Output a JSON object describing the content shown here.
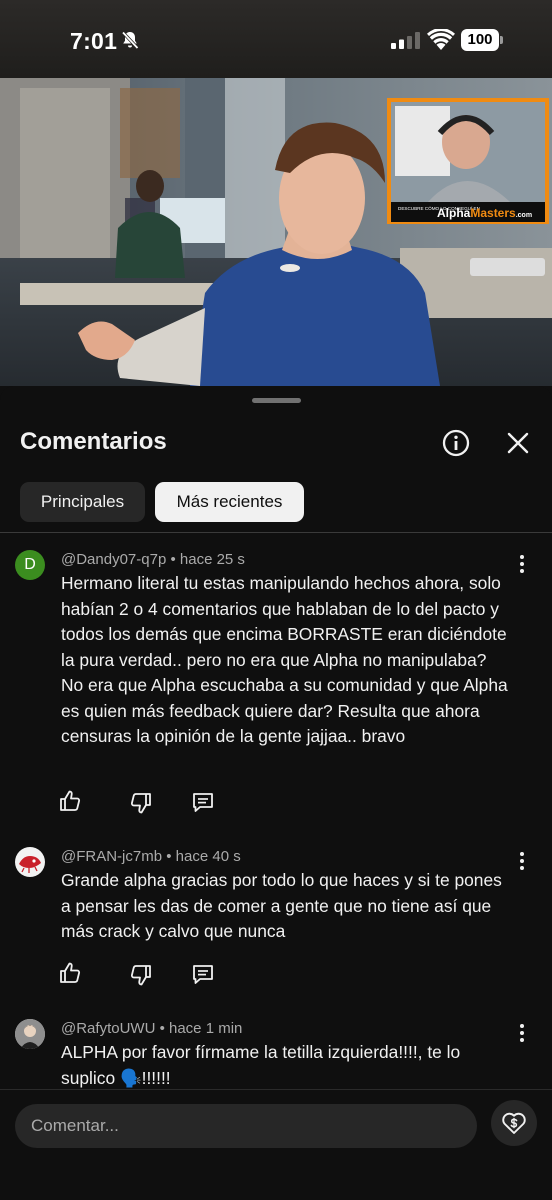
{
  "status_bar": {
    "time": "7:01",
    "battery": "100"
  },
  "video": {
    "overlay_caption": "DESCUBRE CÓMO LO CONSEGUÍ EN",
    "overlay_brand_a": "Alpha",
    "overlay_brand_b": "Masters",
    "overlay_brand_c": ".com"
  },
  "sheet": {
    "title": "Comentarios",
    "chips": [
      "Principales",
      "Más recientes"
    ],
    "selected_chip": "Más recientes"
  },
  "comments": [
    {
      "avatar_letter": "D",
      "author": "@Dandy07-q7p",
      "time": "hace 25 s",
      "text": "Hermano literal tu estas manipulando hechos ahora, solo habían 2 o 4 comentarios que hablaban de lo del pacto y todos los demás que encima BORRASTE eran diciéndote la pura verdad.. pero no era que Alpha no manipulaba? No era que Alpha escuchaba a su comunidad y que Alpha es quien más feedback quiere dar? Resulta que ahora censuras la opinión de la gente jajjaa.. bravo"
    },
    {
      "avatar_letter": "",
      "author": "@FRAN-jc7mb",
      "time": "hace 40 s",
      "text": "Grande alpha gracias por todo lo que haces y si te pones a pensar les das de comer a gente que no tiene así que más crack y calvo que nunca"
    },
    {
      "avatar_letter": "",
      "author": "@RafytoUWU",
      "time": "hace 1 min",
      "text": "ALPHA por favor fírmame la tetilla izquierda!!!!, te lo suplico 🗣️!!!!!!"
    }
  ],
  "composer": {
    "placeholder": "Comentar..."
  },
  "colors": {
    "background": "#0f0f0f",
    "chip_inactive": "#272727",
    "chip_active": "#f1f1f1",
    "meta_text": "#aaaaaa",
    "avatar_green": "#3b8d1f"
  }
}
